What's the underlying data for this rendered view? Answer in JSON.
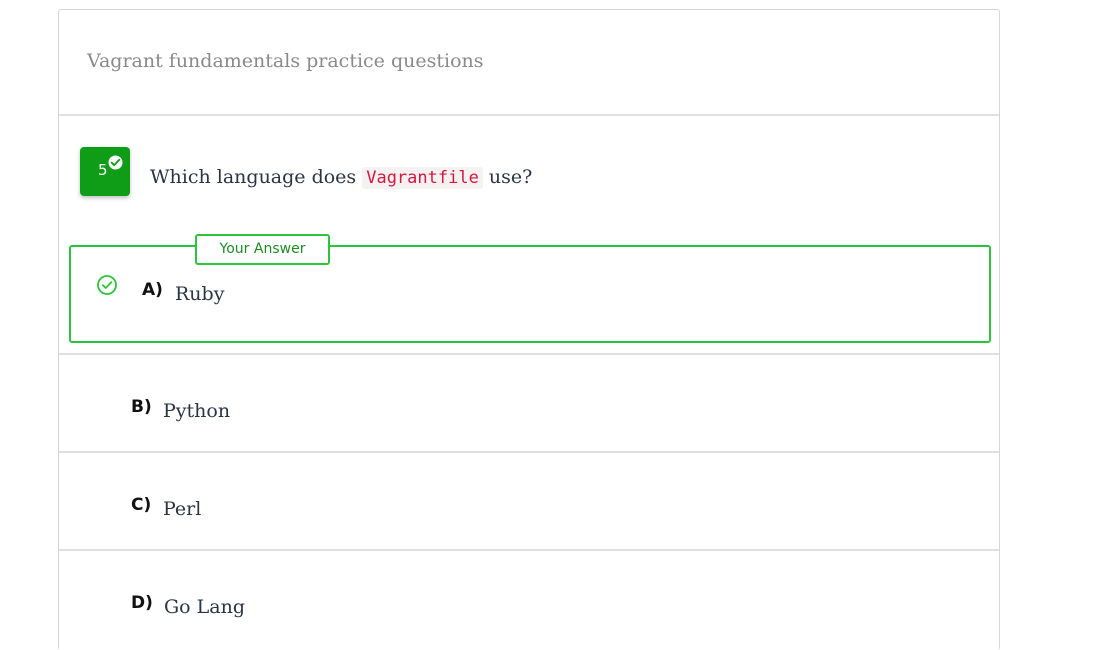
{
  "quiz": {
    "title": "Vagrant fundamentals practice questions"
  },
  "question": {
    "number": "5",
    "text_before": "Which language does ",
    "code": "Vagrantfile",
    "text_after": " use?",
    "status": "correct"
  },
  "answer_badge": "Your Answer",
  "options": [
    {
      "letter": "A)",
      "text": "Ruby",
      "selected": true
    },
    {
      "letter": "B)",
      "text": "Python",
      "selected": false
    },
    {
      "letter": "C)",
      "text": "Perl",
      "selected": false
    },
    {
      "letter": "D)",
      "text": "Go Lang",
      "selected": false
    }
  ],
  "colors": {
    "badge_green": "#0f9d18",
    "correct_border": "#2cc43a",
    "code_text": "#d6173f"
  },
  "icons": {
    "question_status": "check-circle-icon",
    "selected_option": "check-circle-outline-icon"
  }
}
